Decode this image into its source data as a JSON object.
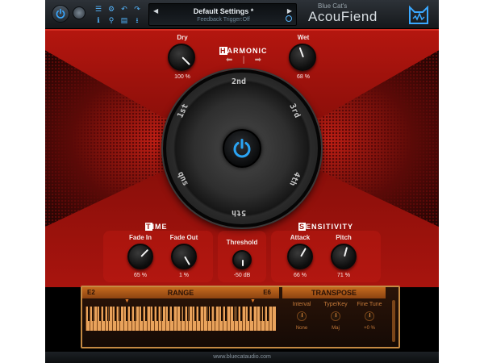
{
  "header": {
    "preset_name": "Default Settings *",
    "preset_sub": "Feedback Trigger:Off",
    "brand_small": "Blue Cat's",
    "brand_big": "AcouFiend",
    "toolbar_icons": [
      "menu-icon",
      "settings-icon",
      "undo-icon",
      "redo-icon",
      "info-icon",
      "zoom-icon",
      "presets-icon",
      "save-icon"
    ]
  },
  "harmonic": {
    "title_cap": "H",
    "title_rest": "ARMONIC",
    "dry_label": "Dry",
    "dry_value": "100 %",
    "wet_label": "Wet",
    "wet_value": "68 %",
    "speaker_labels": [
      "2nd",
      "3rd",
      "4th",
      "5th",
      "sub",
      "1st"
    ]
  },
  "time": {
    "title_cap": "T",
    "title_rest": "IME",
    "fade_in_label": "Fade In",
    "fade_in_value": "65 %",
    "fade_out_label": "Fade Out",
    "fade_out_value": "1 %"
  },
  "threshold": {
    "label": "Threshold",
    "value": "-50 dB"
  },
  "sensitivity": {
    "title_cap": "S",
    "title_rest": "ENSITIVITY",
    "attack_label": "Attack",
    "attack_value": "66 %",
    "pitch_label": "Pitch",
    "pitch_value": "71 %"
  },
  "range": {
    "title": "RANGE",
    "low": "E2",
    "high": "E6"
  },
  "transpose": {
    "title": "TRANSPOSE",
    "interval_label": "Interval",
    "interval_value": "None",
    "type_label": "Type/Key",
    "type_value": "Maj",
    "fine_label": "Fine Tune",
    "fine_value": "+0 %"
  },
  "footer": {
    "url": "www.bluecataudio.com"
  },
  "colors": {
    "accent_blue": "#2aa4f4",
    "red_panel": "#a8140e",
    "orange": "#c56a1e"
  }
}
